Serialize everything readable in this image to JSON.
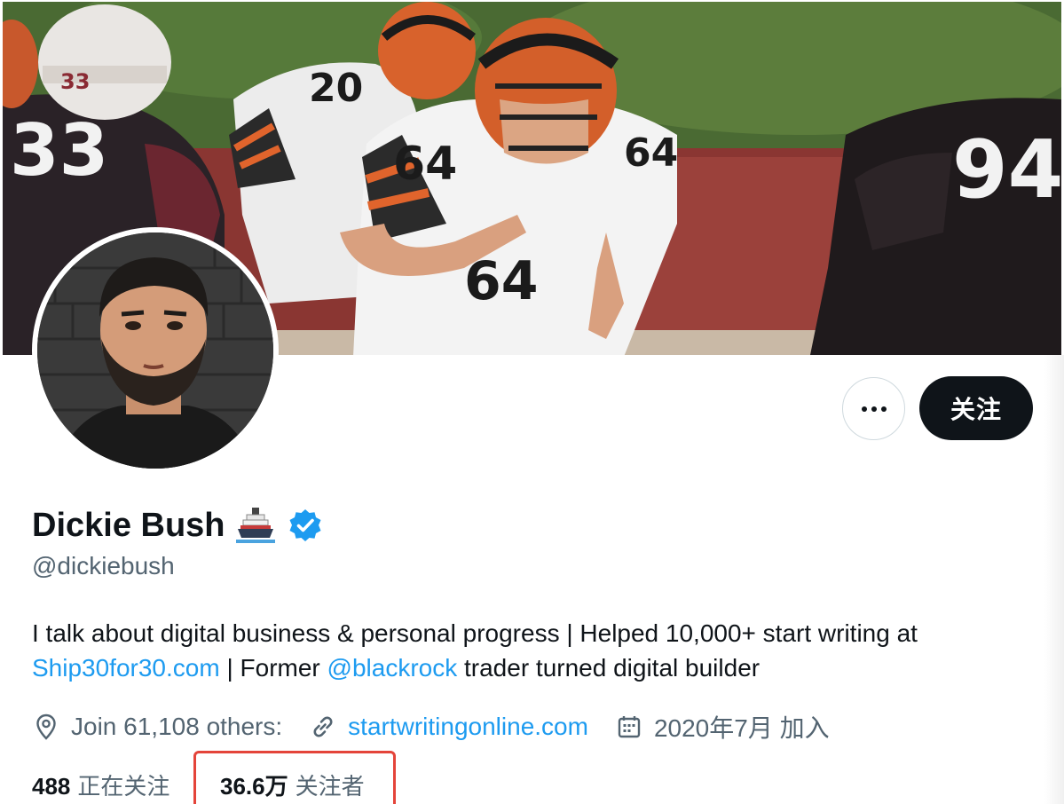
{
  "profile": {
    "display_name": "Dickie Bush",
    "name_emoji_icon": "ship-icon",
    "verified_icon": "verified-badge-icon",
    "handle": "@dickiebush",
    "bio": {
      "line1_text": "I talk about digital business & personal progress | Helped 10,000+ start writing at",
      "line2_link1": "Ship30for30.com",
      "line2_mid": " | Former ",
      "line2_link2": "@blackrock",
      "line2_end": " trader turned digital builder"
    },
    "meta": {
      "location": "Join 61,108 others:",
      "website": "startwritingonline.com",
      "joined": "2020年7月 加入"
    },
    "stats": {
      "following_count": "488",
      "following_label": "正在关注",
      "followers_count": "36.6万",
      "followers_label": "关注者"
    }
  },
  "actions": {
    "more_label": "...",
    "follow_label": "关注"
  },
  "banner": {
    "jersey_numbers": [
      "33",
      "20",
      "64",
      "94"
    ]
  },
  "colors": {
    "link": "#1d9bf0",
    "follow_button_bg": "#0f1419",
    "secondary_text": "#536471",
    "highlight_box": "#e4443a",
    "verified": "#1d9bf0"
  }
}
